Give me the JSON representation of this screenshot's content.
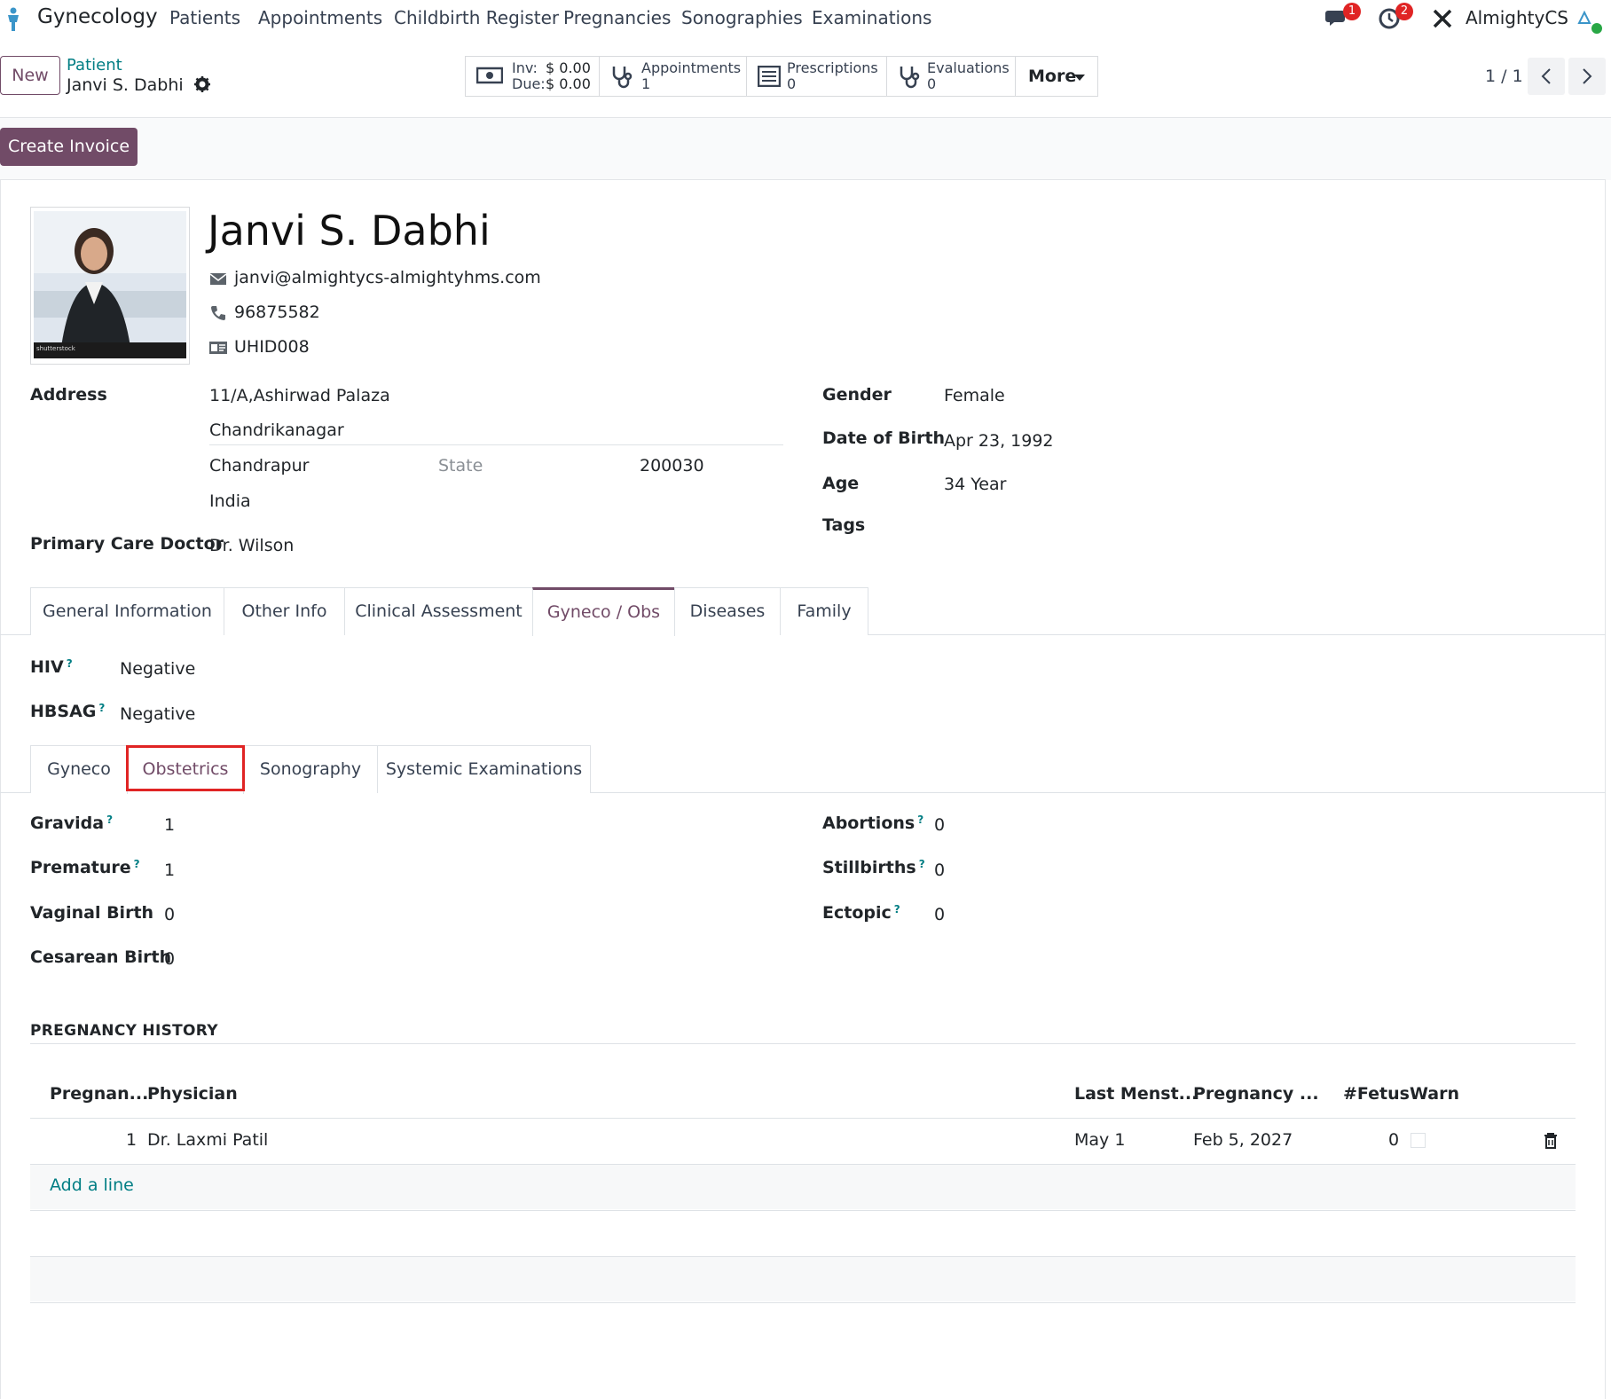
{
  "navbar": {
    "app_name": "Gynecology",
    "menu": [
      "Patients",
      "Appointments",
      "Childbirth Register",
      "Pregnancies",
      "Sonographies",
      "Examinations"
    ],
    "messages_badge": "1",
    "activity_badge": "2",
    "company": "AlmightyCS"
  },
  "controlbar": {
    "new_label": "New",
    "breadcrumb_parent": "Patient",
    "breadcrumb_current": "Janvi S. Dabhi",
    "invoice": {
      "inv_label": "Inv:",
      "inv_value": "$ 0.00",
      "due_label": "Due:",
      "due_value": "$ 0.00"
    },
    "appointments": {
      "label": "Appointments",
      "count": "1"
    },
    "prescriptions": {
      "label": "Prescriptions",
      "count": "0"
    },
    "evaluations": {
      "label": "Evaluations",
      "count": "0"
    },
    "more_label": "More",
    "pager": "1 / 1"
  },
  "actions": {
    "create_invoice": "Create Invoice"
  },
  "patient": {
    "name": "Janvi S. Dabhi",
    "email": "janvi@almightycs-almightyhms.com",
    "phone": "96875582",
    "uhid": "UHID008",
    "photo_caption": "shutterstock"
  },
  "details": {
    "address_label": "Address",
    "street": "11/A,Ashirwad Palaza",
    "street2": "Chandrikanagar",
    "city": "Chandrapur",
    "state_placeholder": "State",
    "zip": "200030",
    "country": "India",
    "primary_doctor_label": "Primary Care Doctor",
    "primary_doctor": "Dr. Wilson",
    "gender_label": "Gender",
    "gender": "Female",
    "dob_label": "Date of Birth",
    "dob": "Apr 23, 1992",
    "age_label": "Age",
    "age": "34 Year",
    "tags_label": "Tags"
  },
  "tabs": [
    "General Information",
    "Other Info",
    "Clinical Assessment",
    "Gyneco / Obs",
    "Diseases",
    "Family"
  ],
  "gyneco_obs": {
    "hiv_label": "HIV",
    "hiv": "Negative",
    "hbsag_label": "HBSAG",
    "hbsag": "Negative"
  },
  "subtabs": [
    "Gyneco",
    "Obstetrics",
    "Sonography",
    "Systemic Examinations"
  ],
  "obstetrics": {
    "gravida_label": "Gravida",
    "gravida": "1",
    "premature_label": "Premature",
    "premature": "1",
    "vaginal_label": "Vaginal Birth",
    "vaginal": "0",
    "cesarean_label": "Cesarean Birth",
    "cesarean": "0",
    "abortions_label": "Abortions",
    "abortions": "0",
    "stillbirths_label": "Stillbirths",
    "stillbirths": "0",
    "ectopic_label": "Ectopic",
    "ectopic": "0"
  },
  "pregnancy_history": {
    "title": "PREGNANCY HISTORY",
    "columns": [
      "Pregnan...",
      "Physician",
      "Last Menst...",
      "Pregnancy ...",
      "#Fetus",
      "Warn"
    ],
    "rows": [
      {
        "number": "1",
        "physician": "Dr. Laxmi Patil",
        "last_menst": "May 1",
        "pregnancy_date": "Feb 5, 2027",
        "fetus": "0"
      }
    ],
    "add_line": "Add a line"
  },
  "colors": {
    "brand": "#714b67",
    "link": "#017e84",
    "badge": "#e02424",
    "highlight": "#e02424"
  }
}
